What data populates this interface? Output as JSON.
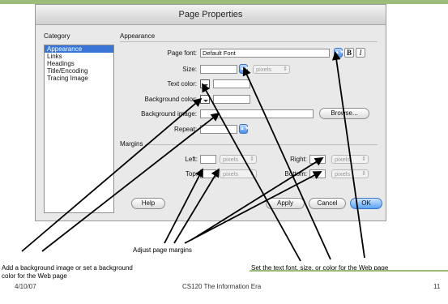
{
  "dialog": {
    "title": "Page Properties",
    "category_header": "Category",
    "section_header": "Appearance",
    "categories": [
      {
        "label": "Appearance",
        "selected": true
      },
      {
        "label": "Links",
        "selected": false
      },
      {
        "label": "Headings",
        "selected": false
      },
      {
        "label": "Title/Encoding",
        "selected": false
      },
      {
        "label": "Tracing Image",
        "selected": false
      }
    ],
    "labels": {
      "page_font": "Page font:",
      "size": "Size:",
      "text_color": "Text color:",
      "background_color": "Background color:",
      "background_image": "Background image:",
      "repeat": "Repeat:",
      "margins": "Margins",
      "left": "Left:",
      "right": "Right:",
      "top": "Top:",
      "bottom": "Bottom:"
    },
    "values": {
      "page_font": "Default Font",
      "size_units": "pixels",
      "margin_units": "pixels"
    },
    "style_buttons": {
      "bold": "B",
      "italic": "I"
    },
    "buttons": {
      "browse": "Browse...",
      "help": "Help",
      "apply": "Apply",
      "cancel": "Cancel",
      "ok": "OK"
    }
  },
  "annotations": {
    "margins": "Adjust page margins",
    "background": "Add a background image or set a background color for the Web page",
    "text": "Set the text font, size, or color for the Web page"
  },
  "footer": {
    "date": "4/10/07",
    "course": "CS120 The Information Era",
    "page": "11"
  },
  "colors": {
    "accent_bar": "#9bbd7a",
    "selection": "#3875d7",
    "primary_button": "#5ba2f2"
  }
}
